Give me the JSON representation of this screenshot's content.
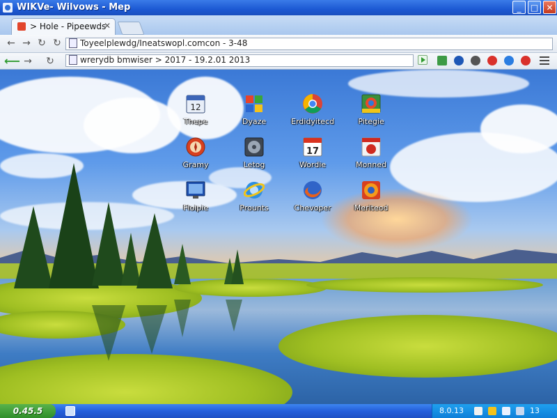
{
  "window": {
    "title": "WIKVe- Wilvows - Mep",
    "min_label": "_",
    "max_label": "□",
    "close_label": "✕"
  },
  "tab": {
    "title": "> Hole - Pipeewds",
    "close_label": "✕"
  },
  "toolbar1": {
    "back": "←",
    "forward": "→",
    "reload": "↻",
    "url": "Toyeelplewdg/Ineatswopl.comcon - 3-48"
  },
  "toolbar2": {
    "back": "⟵",
    "forward": "→",
    "reload": "↻",
    "url": "wrerydb bmwiser > 2017 - 19.2.01 2013"
  },
  "desktop_icons": [
    {
      "label": "Thepe",
      "icon": "calendar-icon"
    },
    {
      "label": "Dyaze",
      "icon": "windows-logo-icon"
    },
    {
      "label": "Erdidyitecd",
      "icon": "chrome-icon"
    },
    {
      "label": "Pitegie",
      "icon": "photo-icon"
    },
    {
      "label": "Gramy",
      "icon": "compass-icon"
    },
    {
      "label": "Letog",
      "icon": "disk-icon"
    },
    {
      "label": "Wordie",
      "icon": "calendar-17-icon"
    },
    {
      "label": "Monned",
      "icon": "red-app-icon"
    },
    {
      "label": "Floipie",
      "icon": "monitor-icon"
    },
    {
      "label": "Prounts",
      "icon": "internet-explorer-icon"
    },
    {
      "label": "Chevoper",
      "icon": "firefox-icon"
    },
    {
      "label": "Meriteod",
      "icon": "firefox-orange-icon"
    }
  ],
  "calendar_number": "12",
  "calendar_17_number": "17",
  "taskbar": {
    "start_label": "0.45.5",
    "tray_time": "8.0.13",
    "tray_clock": "13"
  },
  "colors": {
    "titlebar": "#1c59d3",
    "taskbar": "#245edb",
    "start_button": "#2f8e2a",
    "sky_top": "#3b79d6",
    "grass": "#9fbf22"
  }
}
